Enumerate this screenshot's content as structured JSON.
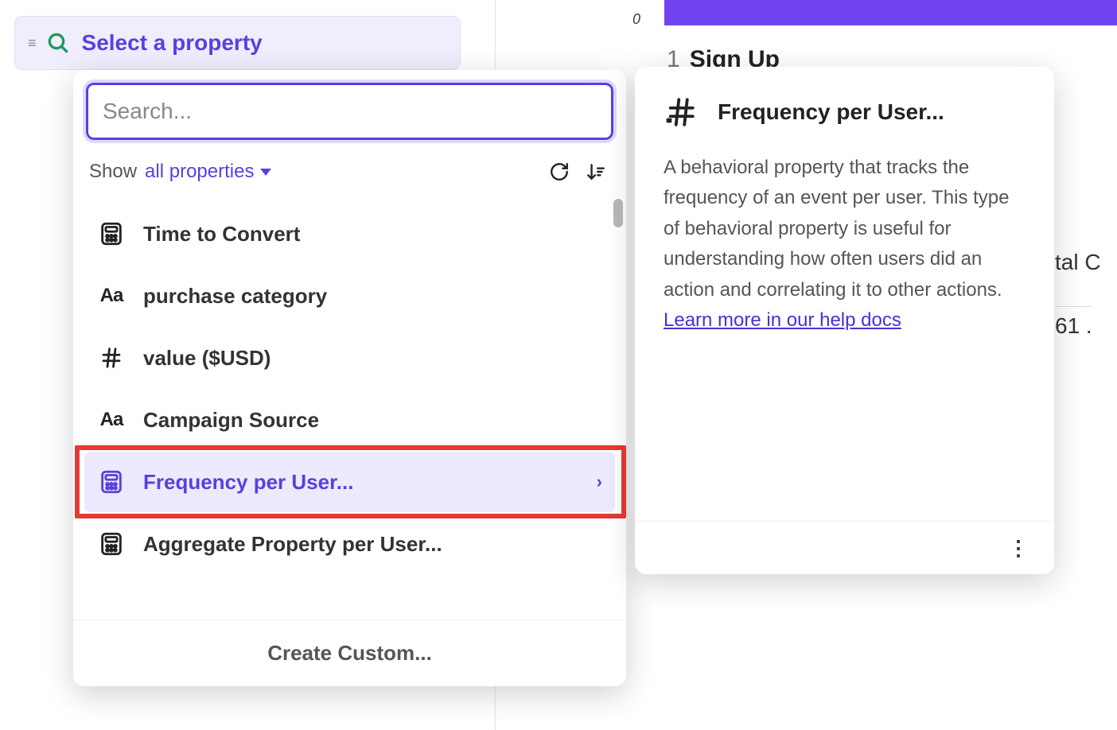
{
  "background": {
    "count_badge": "0",
    "step_number": "1",
    "step_name": "Sign Up",
    "partial_column_header": "tal C",
    "partial_column_value": "61 ."
  },
  "trigger": {
    "label": "Select a property"
  },
  "dropdown": {
    "search_placeholder": "Search...",
    "show_label": "Show",
    "filter_label": "all properties",
    "items": [
      {
        "icon": "calc",
        "label": "Time to Convert"
      },
      {
        "icon": "text",
        "label": "purchase category"
      },
      {
        "icon": "number",
        "label": "value ($USD)"
      },
      {
        "icon": "text",
        "label": "Campaign Source"
      },
      {
        "icon": "calc",
        "label": "Frequency per User...",
        "selected": true,
        "chevron": true
      },
      {
        "icon": "calc",
        "label": "Aggregate Property per User..."
      }
    ],
    "footer_label": "Create Custom..."
  },
  "detail": {
    "title": "Frequency per User...",
    "description_pre": "A behavioral property that tracks the frequency of an event per user. This type of behavioral property is useful for understanding how often users did an action and correlating it to other actions. ",
    "link_text": "Learn more in our help docs"
  }
}
